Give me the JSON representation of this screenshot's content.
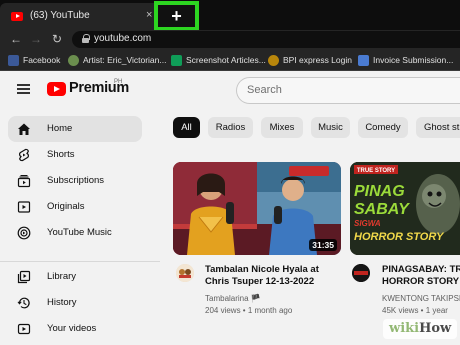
{
  "browser": {
    "tab_title": "(63) YouTube",
    "tab_close": "×",
    "new_tab_label": "+",
    "back": "←",
    "forward": "→",
    "reload": "↻",
    "url": "youtube.com"
  },
  "bookmarks": [
    {
      "label": "Facebook",
      "icon": "facebook-icon",
      "color": "#3b5998"
    },
    {
      "label": "Artist: Eric_Victorian...",
      "icon": "image-icon",
      "color": "#6b8e4e"
    },
    {
      "label": "Screenshot Articles...",
      "icon": "spreadsheet-icon",
      "color": "#0f9d58"
    },
    {
      "label": "BPI express Login",
      "icon": "bpi-icon",
      "color": "#b8860b"
    },
    {
      "label": "Invoice Submission...",
      "icon": "document-icon",
      "color": "#4a7bd1"
    }
  ],
  "header": {
    "brand": "Premium",
    "country_code": "PH",
    "search_placeholder": "Search"
  },
  "sidebar": {
    "items": [
      {
        "label": "Home",
        "icon": "home-icon",
        "active": true
      },
      {
        "label": "Shorts",
        "icon": "shorts-icon",
        "active": false
      },
      {
        "label": "Subscriptions",
        "icon": "subscriptions-icon",
        "active": false
      },
      {
        "label": "Originals",
        "icon": "originals-icon",
        "active": false
      },
      {
        "label": "YouTube Music",
        "icon": "music-icon",
        "active": false
      },
      {
        "label": "Library",
        "icon": "library-icon",
        "active": false
      },
      {
        "label": "History",
        "icon": "history-icon",
        "active": false
      },
      {
        "label": "Your videos",
        "icon": "your-videos-icon",
        "active": false
      }
    ]
  },
  "chips": [
    "All",
    "Radios",
    "Mixes",
    "Music",
    "Comedy",
    "Ghost st"
  ],
  "videos": [
    {
      "title_line1": "Tambalan Nicole Hyala at",
      "title_line2": "Chris Tsuper 12-13-2022",
      "channel": "Tambalarina 🏴",
      "meta": "204 views • 1 month ago",
      "duration": "31:35"
    },
    {
      "thumb_line1": "TRUE STORY",
      "thumb_line2": "PINAG",
      "thumb_line3": "SABAY",
      "thumb_line4": "SIGWA",
      "thumb_line5": "HORROR STORY",
      "title_line1": "PINAGSABAY: TRUE",
      "title_line2": "HORROR STORY",
      "channel": "KWENTONG TAKIPSIL",
      "meta": "45K views • 1 year"
    }
  ],
  "watermark": {
    "part1": "wiki",
    "part2": "How"
  }
}
